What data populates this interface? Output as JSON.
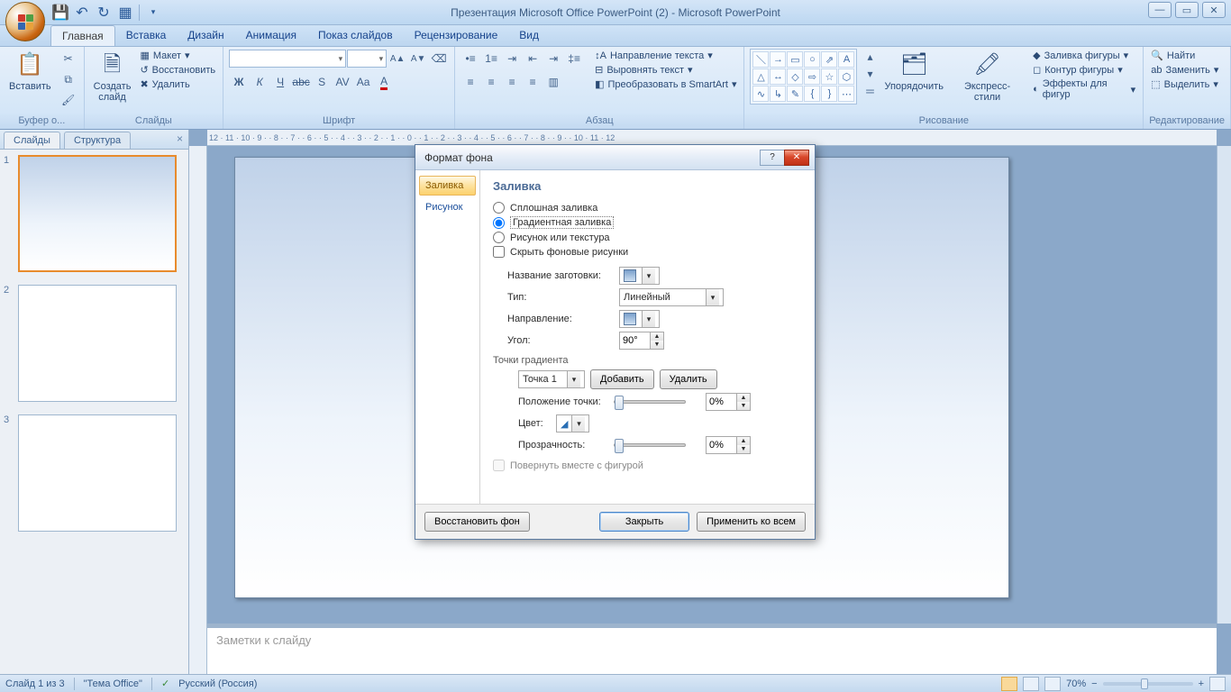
{
  "title": "Презентация Microsoft Office PowerPoint (2) - Microsoft PowerPoint",
  "tabs": {
    "home": "Главная",
    "insert": "Вставка",
    "design": "Дизайн",
    "anim": "Анимация",
    "show": "Показ слайдов",
    "review": "Рецензирование",
    "view": "Вид"
  },
  "ribbon": {
    "clipboard": {
      "label": "Буфер о...",
      "paste": "Вставить"
    },
    "slides": {
      "label": "Слайды",
      "new": "Создать\nслайд",
      "layout": "Макет",
      "reset": "Восстановить",
      "delete": "Удалить"
    },
    "font": {
      "label": "Шрифт"
    },
    "para": {
      "label": "Абзац",
      "dir": "Направление текста",
      "align": "Выровнять текст",
      "smartart": "Преобразовать в SmartArt"
    },
    "draw": {
      "label": "Рисование",
      "arrange": "Упорядочить",
      "styles": "Экспресс-стили",
      "fill": "Заливка фигуры",
      "outline": "Контур фигуры",
      "effects": "Эффекты для фигур"
    },
    "edit": {
      "label": "Редактирование",
      "find": "Найти",
      "replace": "Заменить",
      "select": "Выделить"
    }
  },
  "slidepanel": {
    "slides": "Слайды",
    "outline": "Структура"
  },
  "ruler_text": "12 · 11 · 10 · 9 · · 8 · · 7 · · 6 · · 5 · · 4 · · 3 · · 2 · · 1 · · 0 · · 1 · · 2 · · 3 · · 4 · · 5 · · 6 · · 7 · · 8 · · 9 · · 10 · 11 · 12",
  "notes_placeholder": "Заметки к слайду",
  "statusbar": {
    "slide": "Слайд 1 из 3",
    "theme": "\"Тема Office\"",
    "lang": "Русский (Россия)",
    "zoom": "70%"
  },
  "dialog": {
    "title": "Формат фона",
    "nav": {
      "fill": "Заливка",
      "picture": "Рисунок"
    },
    "heading": "Заливка",
    "opt_solid": "Сплошная заливка",
    "opt_gradient": "Градиентная заливка",
    "opt_picture": "Рисунок или текстура",
    "chk_hidebg": "Скрыть фоновые рисунки",
    "lbl_preset": "Название заготовки:",
    "lbl_type": "Тип:",
    "val_type": "Линейный",
    "lbl_direction": "Направление:",
    "lbl_angle": "Угол:",
    "val_angle": "90°",
    "lbl_stops": "Точки градиента",
    "val_stop": "Точка 1",
    "btn_addstop": "Добавить",
    "btn_delstop": "Удалить",
    "lbl_pos": "Положение точки:",
    "val_pos": "0%",
    "lbl_color": "Цвет:",
    "lbl_trans": "Прозрачность:",
    "val_trans": "0%",
    "chk_rotate": "Повернуть вместе с фигурой",
    "btn_resetbg": "Восстановить фон",
    "btn_close": "Закрыть",
    "btn_applyall": "Применить ко всем"
  }
}
